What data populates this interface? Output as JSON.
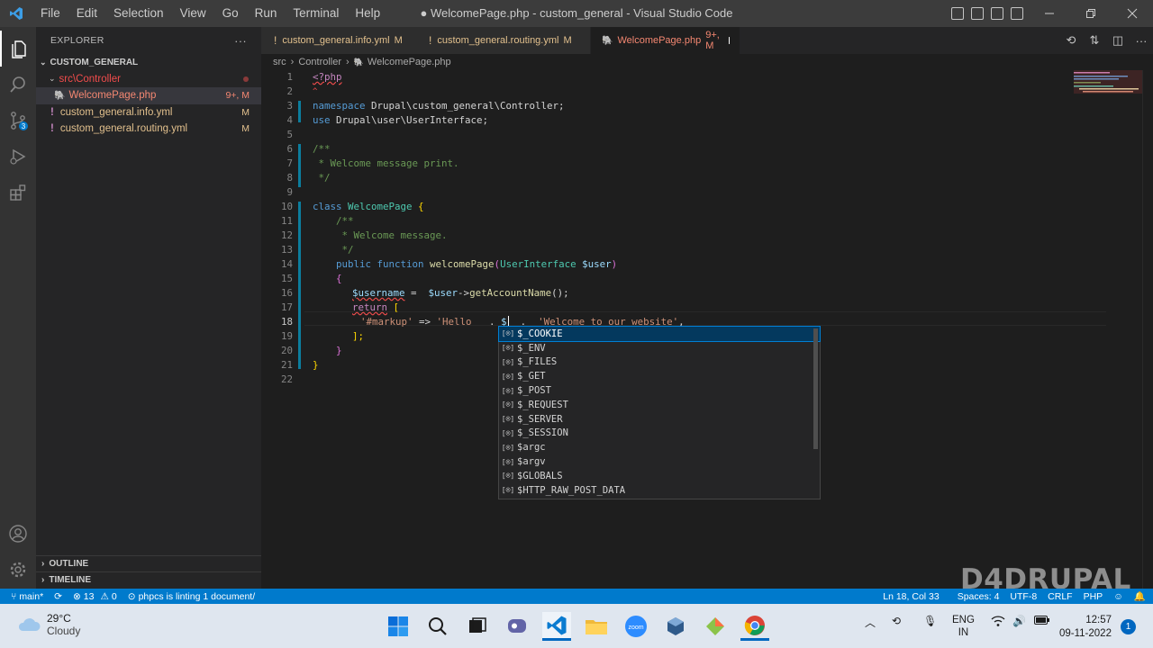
{
  "window": {
    "title": "● WelcomePage.php - custom_general - Visual Studio Code"
  },
  "menu": [
    "File",
    "Edit",
    "Selection",
    "View",
    "Go",
    "Run",
    "Terminal",
    "Help"
  ],
  "explorer": {
    "header": "EXPLORER",
    "more": "···",
    "root": "CUSTOM_GENERAL",
    "folder": "src\\Controller",
    "files": [
      {
        "name": "WelcomePage.php",
        "badge": "9+, M"
      },
      {
        "name": "custom_general.info.yml",
        "badge": "M"
      },
      {
        "name": "custom_general.routing.yml",
        "badge": "M"
      }
    ],
    "outline": "OUTLINE",
    "timeline": "TIMELINE"
  },
  "tabs": [
    {
      "label": "custom_general.info.yml",
      "status": "M"
    },
    {
      "label": "custom_general.routing.yml",
      "status": "M"
    },
    {
      "label": "WelcomePage.php",
      "status": "9+, M"
    }
  ],
  "breadcrumb": {
    "folder1": "src",
    "folder2": "Controller",
    "file": "WelcomePage.php"
  },
  "code": {
    "line_numbers": [
      "1",
      "2",
      "3",
      "4",
      "5",
      "6",
      "7",
      "8",
      "9",
      "10",
      "11",
      "12",
      "13",
      "14",
      "15",
      "16",
      "17",
      "18",
      "19",
      "20",
      "21",
      "22"
    ],
    "l1": "<?php",
    "l2": "^",
    "l3_kw": "namespace",
    "l3_rest": " Drupal\\custom_general\\Controller;",
    "l4_kw": "use",
    "l4_rest": " Drupal\\user\\UserInterface;",
    "l6": "/**",
    "l7": " * Welcome message print.",
    "l8": " */",
    "l10_kw": "class",
    "l10_name": " WelcomePage",
    "l10_brace": " {",
    "l11": "/**",
    "l12": " * Welcome message.",
    "l13": " */",
    "l14_public": "public",
    "l14_function": " function",
    "l14_name": " welcomePage",
    "l14_open": "(",
    "l14_type": "UserInterface",
    "l14_var": " $user",
    "l14_close": ")",
    "l15": "{",
    "l16_var": "$username",
    "l16_op": " =  ",
    "l16_obj": "$user",
    "l16_arrow": "->",
    "l16_method": "getAccountName",
    "l16_end": "();",
    "l17_kw": "return",
    "l17_br": " [",
    "l18_key": "'#markup'",
    "l18_arrow": " => ",
    "l18_hello": "'Hello ",
    "l18_dot": "  . ",
    "l18_typed": "$",
    "l18_dot2": "  .  ",
    "l18_str": "'Welcome to our website'",
    "l18_comma": ",",
    "l19": "];",
    "l20": "}",
    "l21": "}"
  },
  "suggestions": [
    "$_COOKIE",
    "$_ENV",
    "$_FILES",
    "$_GET",
    "$_POST",
    "$_REQUEST",
    "$_SERVER",
    "$_SESSION",
    "$argc",
    "$argv",
    "$GLOBALS",
    "$HTTP_RAW_POST_DATA"
  ],
  "status": {
    "branch": "main*",
    "errors": "13",
    "warnings": "0",
    "linting": "phpcs is linting 1 document/",
    "position": "Ln 18, Col 33",
    "spaces": "Spaces: 4",
    "encoding": "UTF-8",
    "eol": "CRLF",
    "language": "PHP"
  },
  "watermark": "D4DRUPAL",
  "taskbar": {
    "temp": "29°C",
    "weather": "Cloudy",
    "lang1": "ENG",
    "lang2": "IN",
    "time": "12:57",
    "date": "09-11-2022",
    "notif": "1"
  }
}
